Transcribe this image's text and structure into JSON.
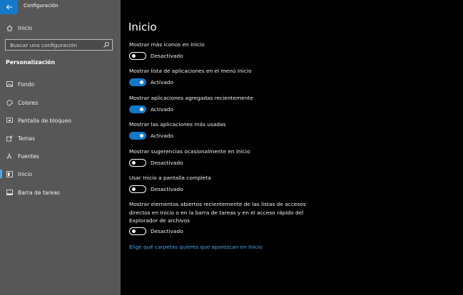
{
  "window": {
    "title": "Configuración"
  },
  "search": {
    "placeholder": "Buscar una configuración"
  },
  "sidebar": {
    "home_label": "Inicio",
    "section_label": "Personalización",
    "items": [
      {
        "label": "Fondo",
        "icon": "image-icon"
      },
      {
        "label": "Colores",
        "icon": "palette-icon"
      },
      {
        "label": "Pantalla de bloqueo",
        "icon": "lock-screen-icon"
      },
      {
        "label": "Temas",
        "icon": "brush-icon"
      },
      {
        "label": "Fuentes",
        "icon": "font-icon"
      },
      {
        "label": "Inicio",
        "icon": "start-icon",
        "active": true
      },
      {
        "label": "Barra de tareas",
        "icon": "taskbar-icon"
      }
    ]
  },
  "main": {
    "title": "Inicio",
    "settings": [
      {
        "label": "Mostrar más iconos en Inicio",
        "state": "Desactivado",
        "on": false
      },
      {
        "label": "Mostrar lista de aplicaciones en el menú Inicio",
        "state": "Activado",
        "on": true
      },
      {
        "label": "Mostrar aplicaciones agregadas recientemente",
        "state": "Activado",
        "on": true
      },
      {
        "label": "Mostrar las aplicaciones más usadas",
        "state": "Activado",
        "on": true
      },
      {
        "label": "Mostrar sugerencias ocasionalmente en Inicio",
        "state": "Desactivado",
        "on": false
      },
      {
        "label": "Usar Inicio a pantalla completa",
        "state": "Desactivado",
        "on": false
      },
      {
        "label_lines": [
          "Mostrar elementos abiertos recientemente de las listas de accesos",
          "directos en Inicio o en la barra de tareas y en el acceso rápido del",
          "Explorador de archivos"
        ],
        "state": "Desactivado",
        "on": false
      }
    ],
    "link": "Elige qué carpetas quieres que aparezcan en Inicio"
  },
  "colors": {
    "accent": "#1479c8",
    "link": "#4aa6ea",
    "sidebar_bg": "#575757",
    "main_bg": "#000000"
  }
}
